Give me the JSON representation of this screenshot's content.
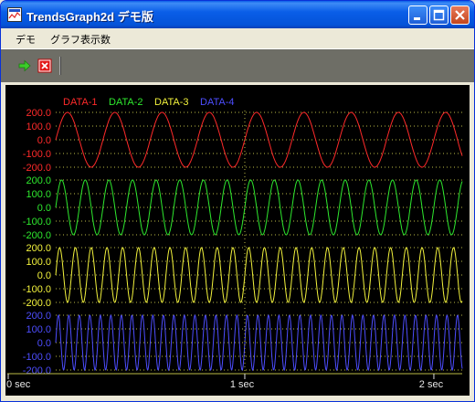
{
  "window": {
    "title": "TrendsGraph2d デモ版"
  },
  "menu": {
    "items": [
      "デモ",
      "グラフ表示数"
    ]
  },
  "toolbar": {
    "run_icon": "green-arrow-icon",
    "stop_icon": "red-x-icon"
  },
  "chart_data": {
    "type": "line",
    "legend": [
      "DATA-1",
      "DATA-2",
      "DATA-3",
      "DATA-4"
    ],
    "colors": [
      "#ff2a2a",
      "#2ee82e",
      "#f2f23c",
      "#4d4dff"
    ],
    "panels": [
      {
        "series": "DATA-1",
        "ylim": [
          -200,
          200
        ],
        "yticks": [
          "200.0",
          "100.0",
          "0.0",
          "-100.0",
          "-200.0"
        ],
        "amplitude": 200,
        "cycles_per_sec": 4.0
      },
      {
        "series": "DATA-2",
        "ylim": [
          -200,
          200
        ],
        "yticks": [
          "200.0",
          "100.0",
          "0.0",
          "-100.0",
          "-200.0"
        ],
        "amplitude": 200,
        "cycles_per_sec": 8.0
      },
      {
        "series": "DATA-3",
        "ylim": [
          -200,
          200
        ],
        "yticks": [
          "200.0",
          "100.0",
          "0.0",
          "-100.0",
          "-200.0"
        ],
        "amplitude": 200,
        "cycles_per_sec": 12.0
      },
      {
        "series": "DATA-4",
        "ylim": [
          -200,
          200
        ],
        "yticks": [
          "200.0",
          "100.0",
          "0.0",
          "-100.0",
          "-200.0"
        ],
        "amplitude": 200,
        "cycles_per_sec": 18.0
      }
    ],
    "x_ticks": [
      {
        "value": 0,
        "label": "0 sec"
      },
      {
        "value": 1,
        "label": "1 sec"
      },
      {
        "value": 2,
        "label": "2 sec"
      }
    ],
    "xlim": [
      0,
      2.15
    ],
    "grid": true
  }
}
